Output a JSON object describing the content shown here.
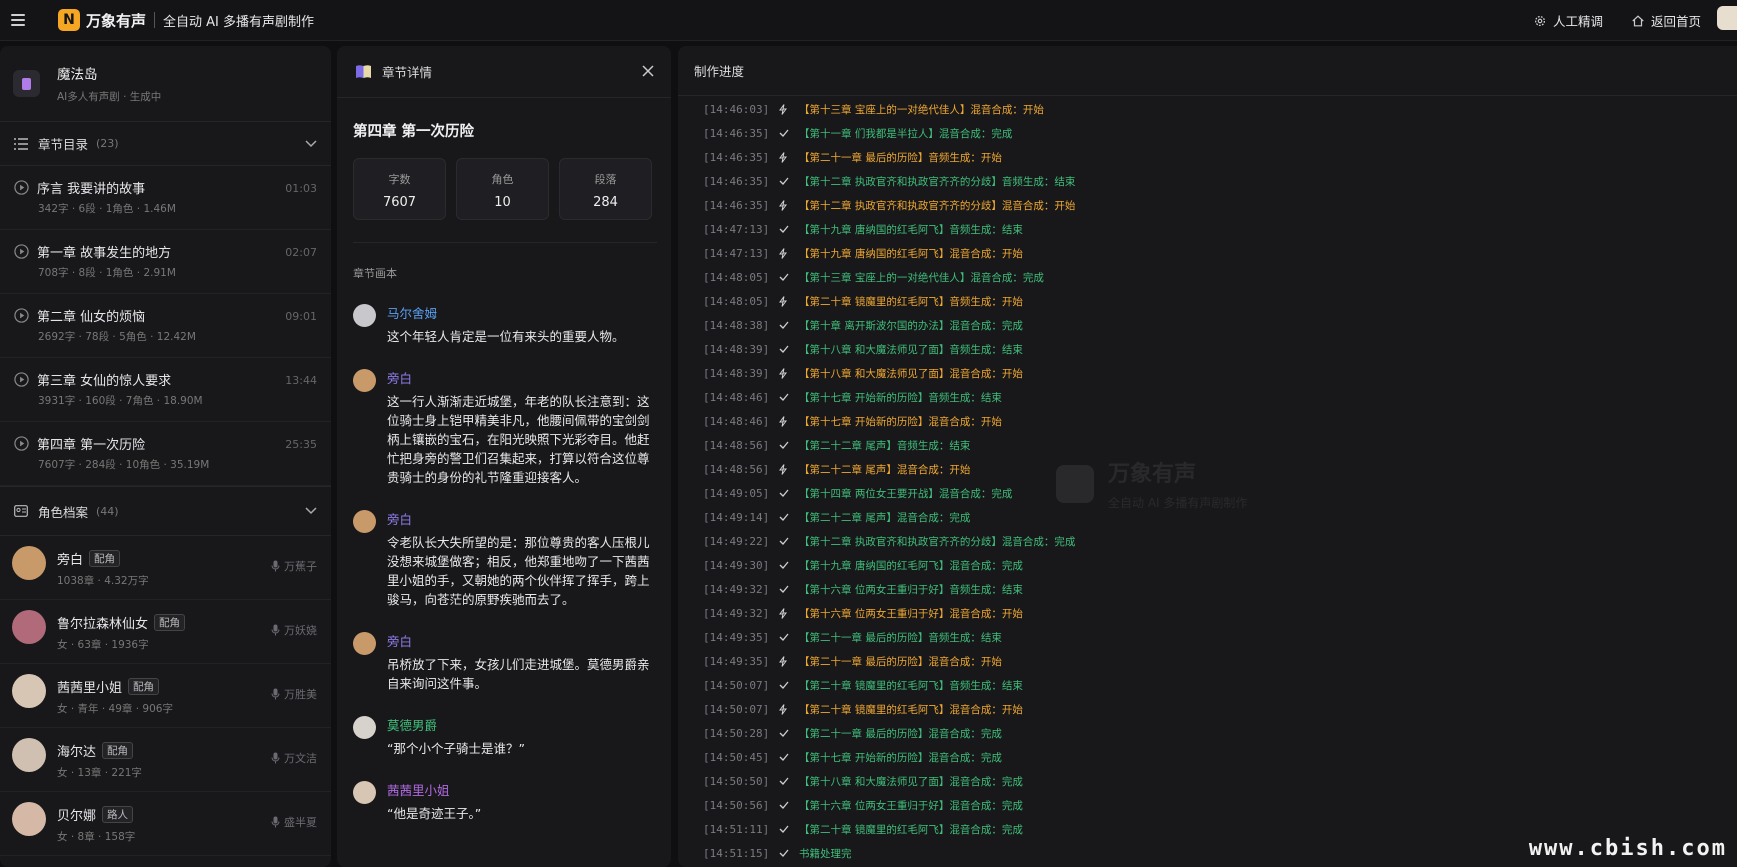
{
  "app": {
    "brand": "万象有声",
    "logo_glyph": "N",
    "subtitle": "全自动 AI 多播有声剧制作",
    "accent": "#f5a623"
  },
  "topbar": {
    "manual_tune": "人工精调",
    "back_home": "返回首页"
  },
  "project": {
    "name": "魔法岛",
    "meta": "AI多人有声剧 · 生成中"
  },
  "chapters_section": {
    "title": "章节目录",
    "count": "(23)",
    "items": [
      {
        "title": "序言 我要讲的故事",
        "duration": "01:03",
        "meta": "342字 · 6段 · 1角色 · 1.46M"
      },
      {
        "title": "第一章 故事发生的地方",
        "duration": "02:07",
        "meta": "708字 · 8段 · 1角色 · 2.91M"
      },
      {
        "title": "第二章 仙女的烦恼",
        "duration": "09:01",
        "meta": "2692字 · 78段 · 5角色 · 12.42M"
      },
      {
        "title": "第三章 女仙的惊人要求",
        "duration": "13:44",
        "meta": "3931字 · 160段 · 7角色 · 18.90M"
      },
      {
        "title": "第四章 第一次历险",
        "duration": "25:35",
        "meta": "7607字 · 284段 · 10角色 · 35.19M"
      }
    ]
  },
  "roles_section": {
    "title": "角色档案",
    "count": "(44)",
    "items": [
      {
        "name": "旁白",
        "tag": "配角",
        "meta": "1038章 · 4.32万字",
        "voice": "万蕉子",
        "avatar_color": "#c89a6a"
      },
      {
        "name": "鲁尔拉森林仙女",
        "tag": "配角",
        "meta": "女 · 63章 · 1936字",
        "voice": "万妖娆",
        "avatar_color": "#b06a7a"
      },
      {
        "name": "茜茜里小姐",
        "tag": "配角",
        "meta": "女 · 青年 · 49章 · 906字",
        "voice": "万胜美",
        "avatar_color": "#d8c6b4"
      },
      {
        "name": "海尔达",
        "tag": "配角",
        "meta": "女 · 13章 · 221字",
        "voice": "万文洁",
        "avatar_color": "#cfc0b2"
      },
      {
        "name": "贝尔娜",
        "tag": "路人",
        "meta": "女 · 8章 · 158字",
        "voice": "盛半夏",
        "avatar_color": "#d6b8a6"
      }
    ]
  },
  "detail": {
    "header": "章节详情",
    "chapter_title": "第四章 第一次历险",
    "stats": [
      {
        "label": "字数",
        "value": "7607"
      },
      {
        "label": "角色",
        "value": "10"
      },
      {
        "label": "段落",
        "value": "284"
      }
    ],
    "script_label": "章节画本",
    "lines": [
      {
        "speaker": "马尔舍姆",
        "color": "#5aa0f0",
        "avatar_color": "#c8c8cc",
        "text": "这个年轻人肯定是一位有来头的重要人物。"
      },
      {
        "speaker": "旁白",
        "color": "#8e7ae6",
        "avatar_color": "#c89a6a",
        "text": "这一行人渐渐走近城堡，年老的队长注意到：这位骑士身上铠甲精美非凡，他腰间佩带的宝剑剑柄上镶嵌的宝石，在阳光映照下光彩夺目。他赶忙把身旁的警卫们召集起来，打算以符合这位尊贵骑士的身份的礼节隆重迎接客人。"
      },
      {
        "speaker": "旁白",
        "color": "#8e7ae6",
        "avatar_color": "#c89a6a",
        "text": "令老队长大失所望的是：那位尊贵的客人压根儿没想来城堡做客；相反，他郑重地吻了一下茜茜里小姐的手，又朝她的两个伙伴挥了挥手，跨上骏马，向苍茫的原野疾驰而去了。"
      },
      {
        "speaker": "旁白",
        "color": "#8e7ae6",
        "avatar_color": "#c89a6a",
        "text": "吊桥放了下来，女孩儿们走进城堡。莫德男爵亲自来询问这件事。"
      },
      {
        "speaker": "莫德男爵",
        "color": "#3fbf7a",
        "avatar_color": "#d8d2cc",
        "text": "“那个小个子骑士是谁？”"
      },
      {
        "speaker": "茜茜里小姐",
        "color": "#b06ae0",
        "avatar_color": "#d8c6b4",
        "text": "“他是奇迹王子。”"
      }
    ]
  },
  "progress": {
    "header": "制作进度",
    "watermark_brand": "万象有声",
    "watermark_sub": "全自动 AI 多播有声剧制作",
    "logs": [
      {
        "ts": "[14:46:03]",
        "type": "start",
        "msg": "【第十三章 宝座上的一对绝代佳人】混音合成：开始"
      },
      {
        "ts": "[14:46:35]",
        "type": "done",
        "msg": "【第十一章 们我都是半拉人】混音合成：完成"
      },
      {
        "ts": "[14:46:35]",
        "type": "start",
        "msg": "【第二十一章 最后的历险】音频生成：开始"
      },
      {
        "ts": "[14:46:35]",
        "type": "done",
        "msg": "【第十二章 执政官齐和执政官齐齐的分歧】音频生成：结束"
      },
      {
        "ts": "[14:46:35]",
        "type": "start",
        "msg": "【第十二章 执政官齐和执政官齐齐的分歧】混音合成：开始"
      },
      {
        "ts": "[14:47:13]",
        "type": "done",
        "msg": "【第十九章 唐纳国的红毛阿飞】音频生成：结束"
      },
      {
        "ts": "[14:47:13]",
        "type": "start",
        "msg": "【第十九章 唐纳国的红毛阿飞】混音合成：开始"
      },
      {
        "ts": "[14:48:05]",
        "type": "done",
        "msg": "【第十三章 宝座上的一对绝代佳人】混音合成：完成"
      },
      {
        "ts": "[14:48:05]",
        "type": "start",
        "msg": "【第二十章 镜魔里的红毛阿飞】音频生成：开始"
      },
      {
        "ts": "[14:48:38]",
        "type": "done",
        "msg": "【第十章 离开斯波尔国的办法】混音合成：完成"
      },
      {
        "ts": "[14:48:39]",
        "type": "done",
        "msg": "【第十八章 和大魔法师见了面】音频生成：结束"
      },
      {
        "ts": "[14:48:39]",
        "type": "start",
        "msg": "【第十八章 和大魔法师见了面】混音合成：开始"
      },
      {
        "ts": "[14:48:46]",
        "type": "done",
        "msg": "【第十七章 开始新的历险】音频生成：结束"
      },
      {
        "ts": "[14:48:46]",
        "type": "start",
        "msg": "【第十七章 开始新的历险】混音合成：开始"
      },
      {
        "ts": "[14:48:56]",
        "type": "done",
        "msg": "【第二十二章 尾声】音频生成：结束"
      },
      {
        "ts": "[14:48:56]",
        "type": "start",
        "msg": "【第二十二章 尾声】混音合成：开始"
      },
      {
        "ts": "[14:49:05]",
        "type": "done",
        "msg": "【第十四章 两位女王要开战】混音合成：完成"
      },
      {
        "ts": "[14:49:14]",
        "type": "done",
        "msg": "【第二十二章 尾声】混音合成：完成"
      },
      {
        "ts": "[14:49:22]",
        "type": "done",
        "msg": "【第十二章 执政官齐和执政官齐齐的分歧】混音合成：完成"
      },
      {
        "ts": "[14:49:30]",
        "type": "done",
        "msg": "【第十九章 唐纳国的红毛阿飞】混音合成：完成"
      },
      {
        "ts": "[14:49:32]",
        "type": "done",
        "msg": "【第十六章 位两女王重归于好】音频生成：结束"
      },
      {
        "ts": "[14:49:32]",
        "type": "start",
        "msg": "【第十六章 位两女王重归于好】混音合成：开始"
      },
      {
        "ts": "[14:49:35]",
        "type": "done",
        "msg": "【第二十一章 最后的历险】音频生成：结束"
      },
      {
        "ts": "[14:49:35]",
        "type": "start",
        "msg": "【第二十一章 最后的历险】混音合成：开始"
      },
      {
        "ts": "[14:50:07]",
        "type": "done",
        "msg": "【第二十章 镜魔里的红毛阿飞】音频生成：结束"
      },
      {
        "ts": "[14:50:07]",
        "type": "start",
        "msg": "【第二十章 镜魔里的红毛阿飞】混音合成：开始"
      },
      {
        "ts": "[14:50:28]",
        "type": "done",
        "msg": "【第二十一章 最后的历险】混音合成：完成"
      },
      {
        "ts": "[14:50:45]",
        "type": "done",
        "msg": "【第十七章 开始新的历险】混音合成：完成"
      },
      {
        "ts": "[14:50:50]",
        "type": "done",
        "msg": "【第十八章 和大魔法师见了面】混音合成：完成"
      },
      {
        "ts": "[14:50:56]",
        "type": "done",
        "msg": "【第十六章 位两女王重归于好】混音合成：完成"
      },
      {
        "ts": "[14:51:11]",
        "type": "done",
        "msg": "【第二十章 镜魔里的红毛阿飞】混音合成：完成"
      },
      {
        "ts": "[14:51:15]",
        "type": "done",
        "msg": "书籍处理完"
      }
    ]
  },
  "site_mark": "www.cbish.com"
}
